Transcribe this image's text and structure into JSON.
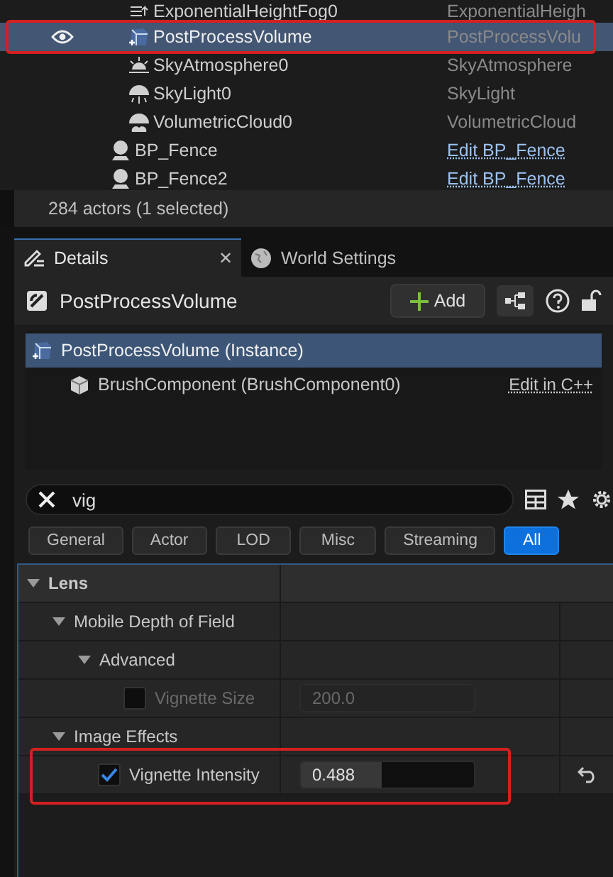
{
  "outliner": {
    "nested_rows": [
      {
        "name": "ExponentialHeightFog0",
        "type": "ExponentialHeigh",
        "kind": "fog",
        "selected": false
      },
      {
        "name": "PostProcessVolume",
        "type": "PostProcessVolu",
        "kind": "volume",
        "selected": true,
        "visible": true,
        "annotated": true
      },
      {
        "name": "SkyAtmosphere0",
        "type": "SkyAtmosphere",
        "kind": "sun",
        "selected": false
      },
      {
        "name": "SkyLight0",
        "type": "SkyLight",
        "kind": "skylight",
        "selected": false
      },
      {
        "name": "VolumetricCloud0",
        "type": "VolumetricCloud",
        "kind": "cloud",
        "selected": false
      }
    ],
    "rows": [
      {
        "name": "BP_Fence",
        "type": "Edit BP_Fence",
        "kind": "pawn",
        "selected": false,
        "link": true
      },
      {
        "name": "BP_Fence2",
        "type": "Edit BP_Fence",
        "kind": "pawn",
        "selected": false,
        "link": true
      }
    ],
    "status": "284 actors (1 selected)"
  },
  "tabs": [
    {
      "label": "Details",
      "kind": "pencil",
      "selected": true,
      "close": "✕"
    },
    {
      "label": "World Settings",
      "kind": "globe",
      "selected": false
    }
  ],
  "header": {
    "title": "PostProcessVolume",
    "add_button": "Add"
  },
  "components": [
    {
      "label": "PostProcessVolume (Instance)",
      "kind": "volume",
      "selected": true,
      "children": [
        {
          "label": "BrushComponent (BrushComponent0)",
          "kind": "box",
          "selected": false,
          "link": "Edit in C++"
        }
      ]
    }
  ],
  "search": {
    "value": "vig"
  },
  "filters": [
    {
      "label": "General",
      "selected": false
    },
    {
      "label": "Actor",
      "selected": false
    },
    {
      "label": "LOD",
      "selected": false
    },
    {
      "label": "Misc",
      "selected": false
    },
    {
      "label": "Streaming",
      "selected": false
    },
    {
      "label": "All",
      "selected": true
    }
  ],
  "properties": [
    {
      "kind": "category",
      "label": "Lens",
      "expanded": true,
      "children": [
        {
          "kind": "group",
          "label": "Mobile Depth of Field",
          "expanded": true,
          "children": [
            {
              "kind": "group",
              "label": "Advanced",
              "expanded": true,
              "children": [
                {
                  "kind": "property",
                  "label": "Vignette Size",
                  "checked": false,
                  "disabled": true,
                  "value": "200.0"
                }
              ]
            }
          ]
        },
        {
          "kind": "group",
          "label": "Image Effects",
          "expanded": true,
          "children": [
            {
              "kind": "property",
              "label": "Vignette Intensity",
              "checked": true,
              "value": "0.488",
              "level": 0.47,
              "annotated": true,
              "reset": true
            }
          ]
        }
      ]
    }
  ]
}
